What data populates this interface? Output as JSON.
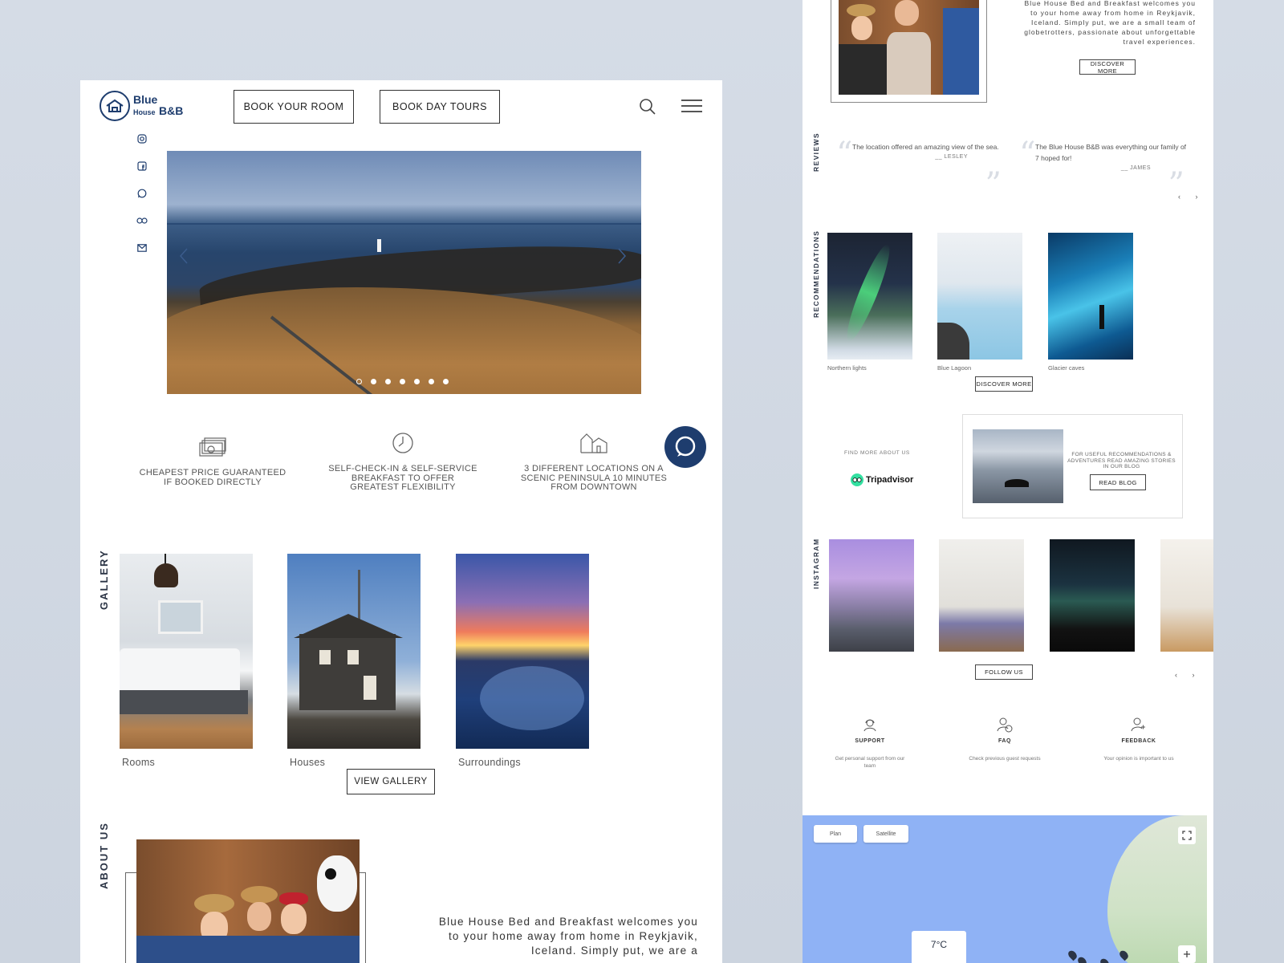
{
  "brand": {
    "line1": "Blue",
    "line2": "House",
    "line3": "B&B"
  },
  "header": {
    "book_room": "BOOK YOUR ROOM",
    "book_tours": "BOOK DAY TOURS"
  },
  "social": [
    "instagram-icon",
    "facebook-icon",
    "whatsapp-icon",
    "tripadvisor-icon",
    "mail-icon"
  ],
  "hero": {
    "slide_count": 7,
    "active_slide": 1
  },
  "features": [
    {
      "icon": "money-icon",
      "text": "CHEAPEST PRICE GUARANTEED IF BOOKED DIRECTLY"
    },
    {
      "icon": "clock-icon",
      "text": "SELF-CHECK-IN & SELF-SERVICE BREAKFAST TO OFFER GREATEST FLEXIBILITY"
    },
    {
      "icon": "houses-icon",
      "text": "3 DIFFERENT LOCATIONS ON A SCENIC PENINSULA 10 MINUTES FROM DOWNTOWN"
    }
  ],
  "gallery": {
    "label": "GALLERY",
    "items": [
      "Rooms",
      "Houses",
      "Surroundings"
    ],
    "button": "VIEW GALLERY"
  },
  "about": {
    "label": "ABOUT US",
    "text": "Blue House Bed and Breakfast welcomes you to your home away from home in Reykjavik, Iceland. Simply put, we are a"
  },
  "right": {
    "about_text": "Blue House Bed and Breakfast welcomes you to your home away from home in Reykjavik, Iceland. Simply put, we are a small team of globetrotters, passionate about unforgettable travel experiences.",
    "discover_more": "DISCOVER MORE",
    "reviews_label": "REVIEWS",
    "reviews": [
      {
        "text": "The location offered an amazing view of the sea.",
        "author": "__ LESLEY"
      },
      {
        "text": "The Blue House B&B was everything our family of 7 hoped for!",
        "author": "__ JAMES"
      }
    ],
    "arrows": "‹ ›",
    "recommendations_label": "RECOMMENDATIONS",
    "recommendations": [
      "Northern lights",
      "Blue Lagoon",
      "Glacier caves"
    ],
    "rec_button": "DISCOVER MORE",
    "find_more": "FIND MORE ABOUT US",
    "tripadvisor": "Tripadvisor",
    "blog_text": "FOR USEFUL RECOMMENDATIONS & ADVENTURES READ AMAZING STORIES IN OUR BLOG",
    "read_blog": "READ BLOG",
    "instagram_label": "INSTAGRAM",
    "follow_us": "FOLLOW US",
    "help": [
      {
        "icon": "support-icon",
        "title": "SUPPORT",
        "desc": "Get personal support from our team"
      },
      {
        "icon": "faq-icon",
        "title": "FAQ",
        "desc": "Check previous guest requests"
      },
      {
        "icon": "feedback-icon",
        "title": "FEEDBACK",
        "desc": "Your opinion is important to us"
      }
    ],
    "map": {
      "plan": "Plan",
      "satellite": "Satellite",
      "temperature": "7°C"
    }
  },
  "colors": {
    "brand_navy": "#1e3d6e",
    "page_bg": "#d5dce6"
  }
}
